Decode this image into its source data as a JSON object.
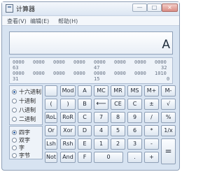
{
  "window": {
    "title": "计算器",
    "controls": {
      "minimize": "—",
      "maximize": "□",
      "close": "×"
    }
  },
  "menu": [
    "查看(V)",
    "编辑(E)",
    "帮助(H)"
  ],
  "display": {
    "value": "A"
  },
  "bit_display": {
    "row1": [
      "0000",
      "0000",
      "0000",
      "0000",
      "0000",
      "0000",
      "0000",
      "0000"
    ],
    "row1_labels": [
      "63",
      "47",
      "32"
    ],
    "row2": [
      "0000",
      "0000",
      "0000",
      "0000",
      "0000",
      "0000",
      "0000",
      "1010"
    ],
    "row2_labels": [
      "31",
      "15",
      "0"
    ]
  },
  "number_systems": [
    {
      "label": "十六进制",
      "selected": true
    },
    {
      "label": "十进制",
      "selected": false
    },
    {
      "label": "八进制",
      "selected": false
    },
    {
      "label": "二进制",
      "selected": false
    }
  ],
  "word_sizes": [
    {
      "label": "四字",
      "selected": true
    },
    {
      "label": "双字",
      "selected": false
    },
    {
      "label": "字",
      "selected": false
    },
    {
      "label": "字节",
      "selected": false
    }
  ],
  "buttons": {
    "mod": "Mod",
    "a": "A",
    "mc": "MC",
    "mr": "MR",
    "ms": "MS",
    "mplus": "M+",
    "mminus": "M-",
    "lparen": "(",
    "rparen": ")",
    "b": "B",
    "backspace": "⟵",
    "ce": "CE",
    "c": "C",
    "plusminus": "±",
    "sqrt": "√",
    "rol": "RoL",
    "ror": "RoR",
    "cbtn": "C",
    "seven": "7",
    "eight": "8",
    "nine": "9",
    "divide": "/",
    "percent": "%",
    "or": "Or",
    "xor": "Xor",
    "d": "D",
    "four": "4",
    "five": "5",
    "six": "6",
    "multiply": "*",
    "reciprocal": "1/x",
    "lsh": "Lsh",
    "rsh": "Rsh",
    "e": "E",
    "one": "1",
    "two": "2",
    "three": "3",
    "minus": "-",
    "equals": "=",
    "not": "Not",
    "and": "And",
    "f": "F",
    "zero": "0",
    "decimal": ".",
    "plus": "+"
  }
}
